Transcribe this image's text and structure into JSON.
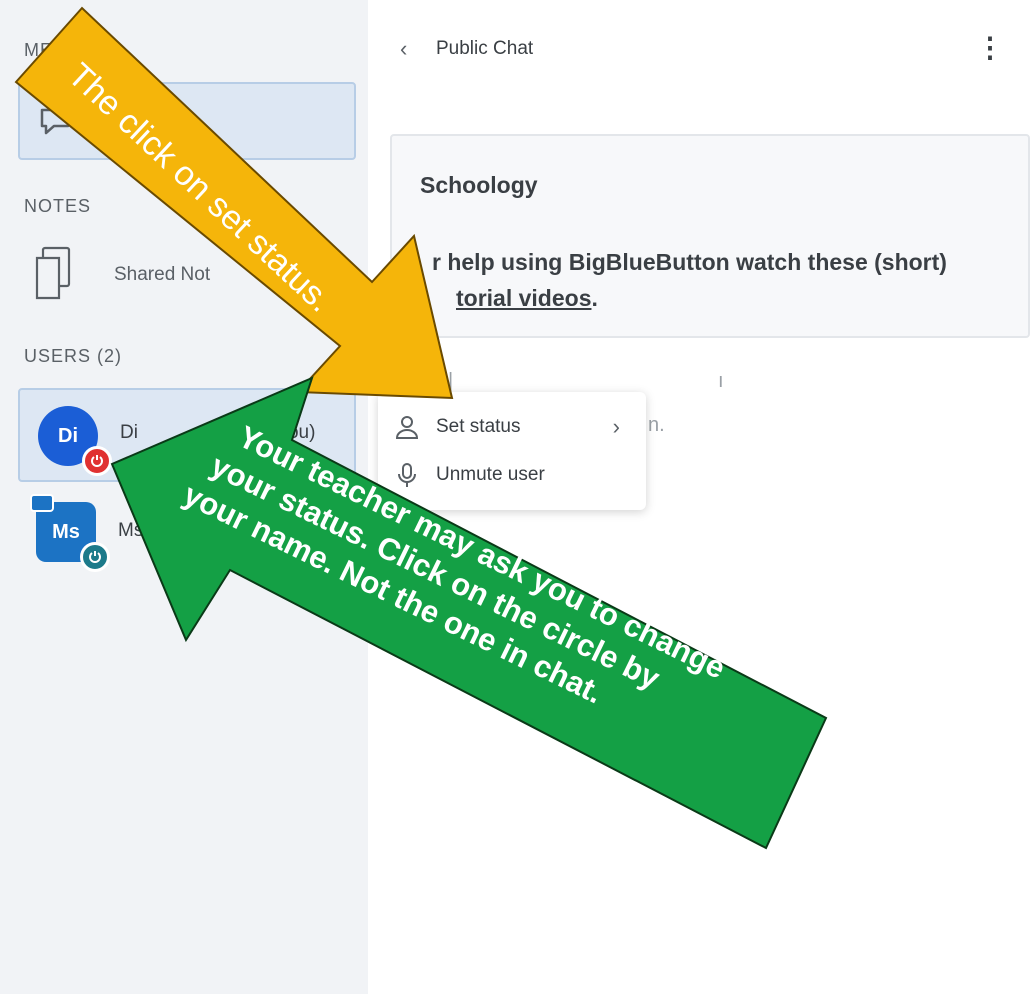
{
  "sidebar": {
    "messages_header": "ME",
    "notes_header": "NOTES",
    "notes_item_label": "Shared Not",
    "users_header": "USERS (2)",
    "users": [
      {
        "initials": "Di",
        "name": "Di",
        "suffix": "ou)",
        "status_color": "#e03131"
      },
      {
        "initials": "Ms",
        "name": "Ms.",
        "status_color": "#1c7a8a"
      }
    ]
  },
  "chat": {
    "back_icon": "chevron-left-icon",
    "title": "Public Chat",
    "menu_icon": "kebab-menu-icon",
    "welcome_name": "Schoology",
    "help_text_before": "r help using BigBlueButton watch these (short)",
    "help_link": "torial videos",
    "help_text_after": ".",
    "faded_text": "n."
  },
  "dropdown": {
    "items": [
      {
        "label": "Set status",
        "icon": "user-icon",
        "has_submenu": true
      },
      {
        "label": "Unmute user",
        "icon": "microphone-icon"
      }
    ]
  },
  "annotations": {
    "orange_arrow_text": "The click on set status.",
    "green_arrow_text": [
      "Your teacher may ask you to change",
      "your status.  Click on the circle by",
      "your name. Not the one in chat."
    ],
    "orange_color": "#f5b50a",
    "green_color": "#14a045"
  }
}
